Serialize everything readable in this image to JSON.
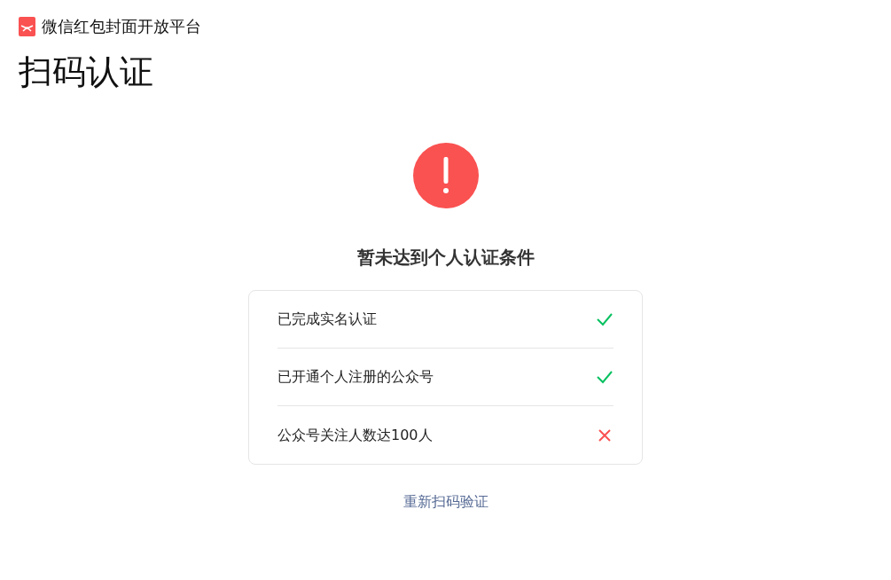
{
  "header": {
    "brand": "微信红包封面开放平台"
  },
  "page_title": "扫码认证",
  "result": {
    "heading": "暂未达到个人认证条件"
  },
  "conditions": [
    {
      "label": "已完成实名认证",
      "met": true
    },
    {
      "label": "已开通个人注册的公众号",
      "met": true
    },
    {
      "label": "公众号关注人数达100人",
      "met": false
    }
  ],
  "retry_link": "重新扫码验证"
}
